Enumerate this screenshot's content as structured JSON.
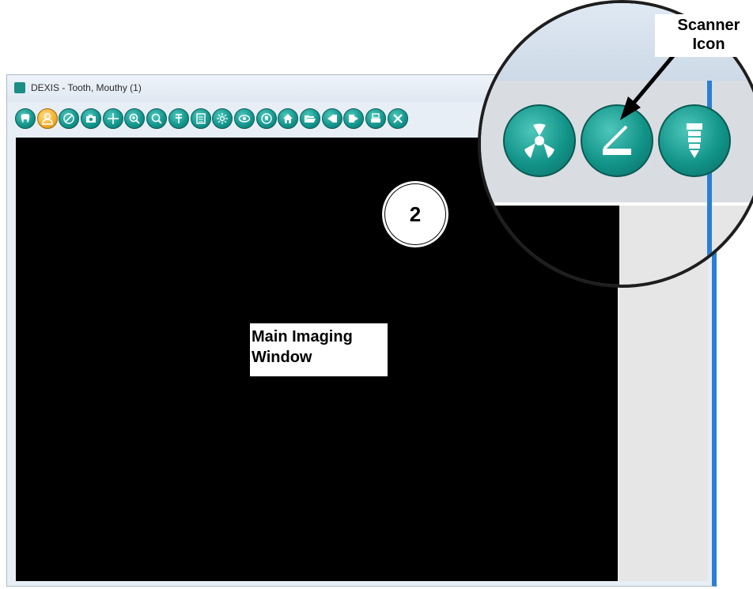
{
  "window": {
    "title": "DEXIS - Tooth, Mouthy (1)"
  },
  "toolbar": {
    "buttons": [
      {
        "name": "tooth-icon"
      },
      {
        "name": "patient-icon",
        "active": true
      },
      {
        "name": "pencil-icon"
      },
      {
        "name": "camera-icon"
      },
      {
        "name": "crosshair-icon"
      },
      {
        "name": "zoom-in-icon"
      },
      {
        "name": "zoom-icon"
      },
      {
        "name": "measure-icon"
      },
      {
        "name": "notes-icon"
      },
      {
        "name": "brightness-icon"
      },
      {
        "name": "eye-icon"
      },
      {
        "name": "tooth-rotate-icon"
      },
      {
        "name": "home-icon"
      },
      {
        "name": "folder-open-icon"
      },
      {
        "name": "import-icon"
      },
      {
        "name": "export-icon"
      },
      {
        "name": "print-icon"
      },
      {
        "name": "close-icon"
      }
    ]
  },
  "annotations": {
    "main_label_line1": "Main Imaging",
    "main_label_line2": "Window",
    "step_number": "2",
    "callout_line1": "Scanner",
    "callout_line2": "Icon"
  },
  "magnified": {
    "buttons": [
      {
        "name": "radiation-icon"
      },
      {
        "name": "scanner-icon"
      },
      {
        "name": "implant-icon"
      }
    ]
  },
  "colors": {
    "button_teal": "#14988f",
    "button_active": "#f4b233",
    "window_accent": "#2a7fd4"
  }
}
